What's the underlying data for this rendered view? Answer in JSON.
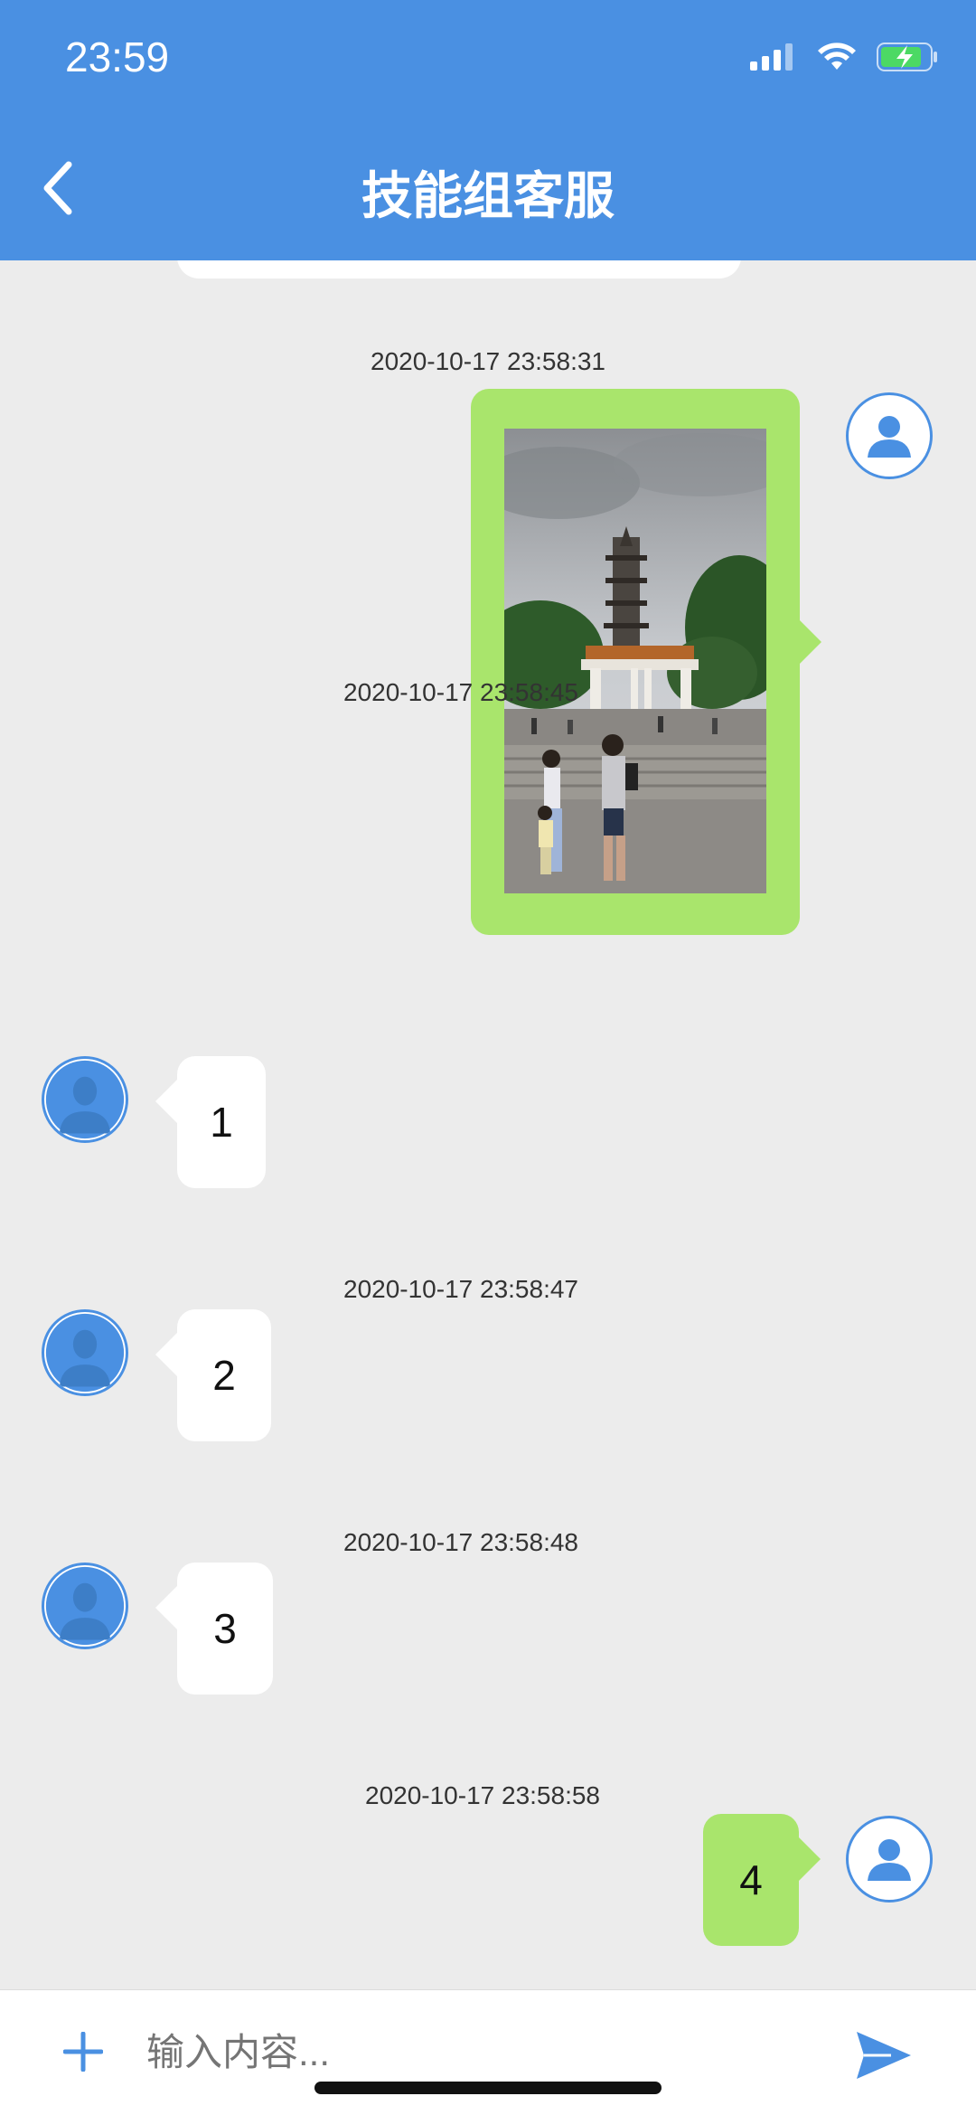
{
  "status": {
    "time": "23:59"
  },
  "header": {
    "title": "技能组客服",
    "back_icon": "chevron-left-icon"
  },
  "messages": [
    {
      "timestamp": "2020-10-17 23:58:31",
      "side": "right",
      "type": "image"
    },
    {
      "timestamp": "2020-10-17 23:58:45",
      "side": "left",
      "text": "1"
    },
    {
      "timestamp": "2020-10-17 23:58:47",
      "side": "left",
      "text": "2"
    },
    {
      "timestamp": "2020-10-17 23:58:48",
      "side": "left",
      "text": "3"
    },
    {
      "timestamp": "2020-10-17 23:58:58",
      "side": "right",
      "text": "4"
    }
  ],
  "input": {
    "placeholder": "输入内容..."
  },
  "colors": {
    "brand": "#4a90e2",
    "self_bubble": "#a9e56c",
    "other_bubble": "#ffffff",
    "background": "#ececec"
  }
}
